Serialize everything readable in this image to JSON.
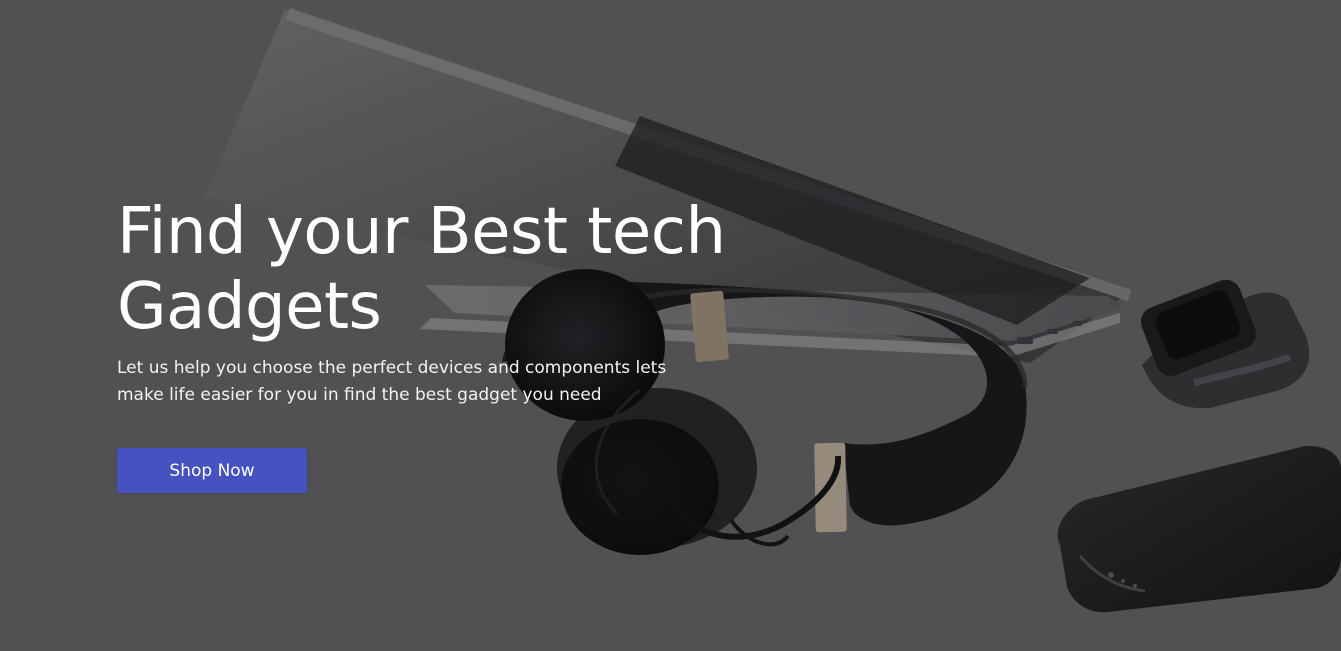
{
  "hero": {
    "title": "Find your Best tech Gadgets",
    "subtitle": "Let us help you choose the perfect devices and components lets make life easier for you in find the best gadget you need",
    "button_label": "Shop Now"
  },
  "colors": {
    "button_background": "#4552BF",
    "hero_text": "#FFFFFF",
    "background_dark": "#5F5F61"
  },
  "icons": {
    "background_objects": [
      "laptop-icon",
      "headphones-icon",
      "smartwatch-icon",
      "smartphone-icon"
    ]
  }
}
